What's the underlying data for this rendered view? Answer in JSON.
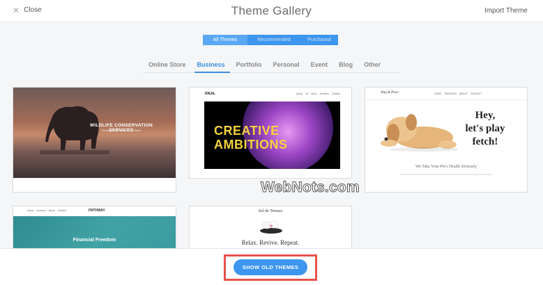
{
  "header": {
    "close_label": "Close",
    "title": "Theme Gallery",
    "import_label": "Import Theme"
  },
  "segments": [
    {
      "label": "All Themes",
      "active": true
    },
    {
      "label": "Recommended",
      "active": false
    },
    {
      "label": "Purchased",
      "active": false
    }
  ],
  "categories": [
    {
      "label": "Online Store",
      "active": false
    },
    {
      "label": "Business",
      "active": true
    },
    {
      "label": "Portfolio",
      "active": false
    },
    {
      "label": "Personal",
      "active": false
    },
    {
      "label": "Event",
      "active": false
    },
    {
      "label": "Blog",
      "active": false
    },
    {
      "label": "Other",
      "active": false
    }
  ],
  "themes": {
    "wildlife": {
      "heading": "WILDLIFE CONSERVATION SERVICES",
      "subheading": "Investing in the Future of Our Planet"
    },
    "creative": {
      "brand": "IDEAL",
      "menu": "About Us Work Services Contact",
      "line1": "CREATIVE",
      "line2": "AMBITIONS"
    },
    "dog": {
      "brand": "Wag & Paws",
      "menu": "HOME SERVICES ABOUT CONTACT",
      "hero_line1": "Hey,",
      "hero_line2": "let's play",
      "hero_line3": "fetch!",
      "tagline": "We Take Your Pet's Health Seriously"
    },
    "pathway": {
      "menu": "Home Services About Contact",
      "brand": "PATHWAY",
      "hero": "Financial Freedom"
    },
    "terrace": {
      "brand": "Sol de Terrace",
      "hero": "Relax. Revive. Repeat."
    }
  },
  "watermark": "WebNots.com",
  "footer": {
    "old_themes_label": "SHOW OLD THEMES"
  },
  "colors": {
    "accent": "#3d96f0",
    "highlight": "#e8534d"
  }
}
